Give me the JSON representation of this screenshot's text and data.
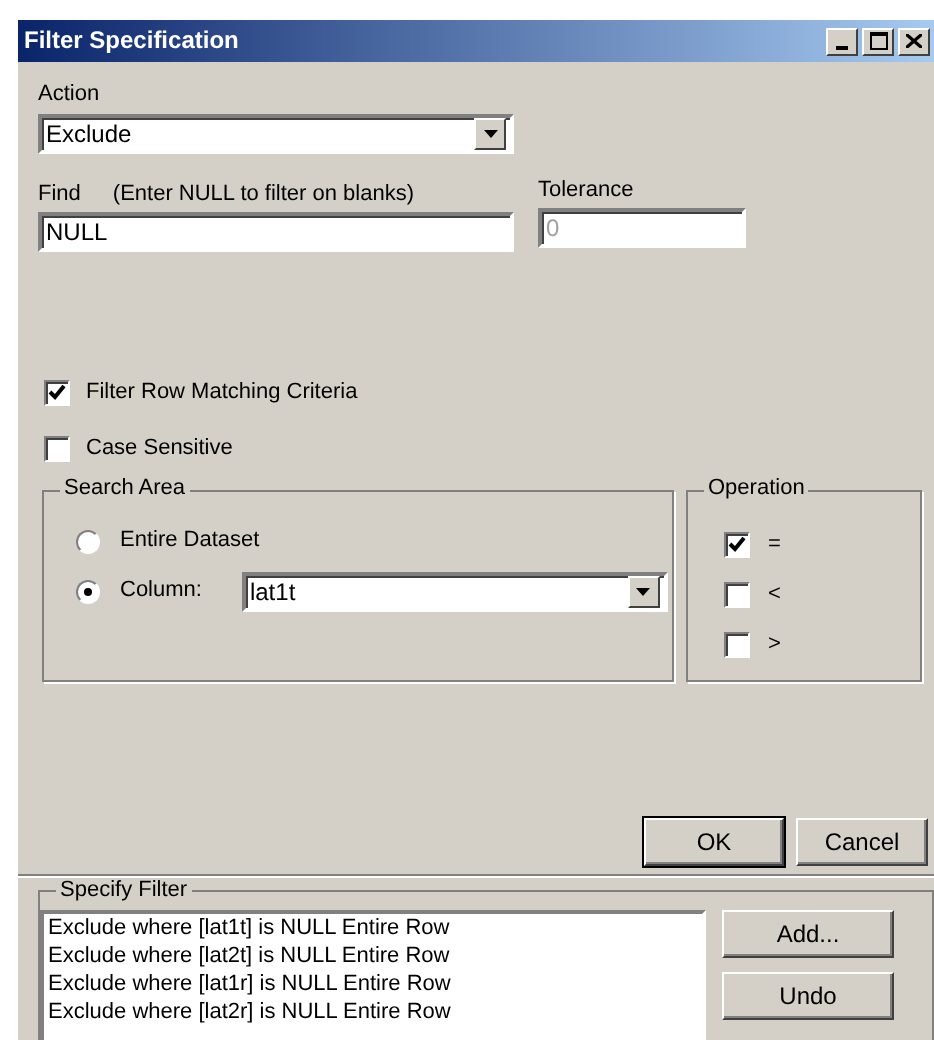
{
  "window": {
    "title": "Filter Specification"
  },
  "action": {
    "label": "Action",
    "value": "Exclude"
  },
  "find": {
    "label": "Find",
    "hint": "(Enter NULL to filter on blanks)",
    "value": "NULL"
  },
  "tolerance": {
    "label": "Tolerance",
    "value": "0",
    "disabled": true
  },
  "options": [
    {
      "label": "Filter Row Matching Criteria",
      "checked": true
    },
    {
      "label": "Case Sensitive",
      "checked": false
    }
  ],
  "search_area": {
    "title": "Search Area",
    "column_value": "lat1t",
    "options": [
      {
        "label": "Entire Dataset",
        "selected": false
      },
      {
        "label": "Column:",
        "selected": true
      }
    ]
  },
  "operation": {
    "title": "Operation",
    "items": [
      {
        "label": "=",
        "checked": true
      },
      {
        "label": "<",
        "checked": false
      },
      {
        "label": ">",
        "checked": false
      }
    ]
  },
  "buttons": [
    "OK",
    "Cancel"
  ],
  "specify_filter": {
    "title": "Specify Filter",
    "rows": [
      "Exclude where [lat1t] is NULL Entire Row",
      "Exclude where [lat2t] is NULL Entire Row",
      "Exclude where [lat1r] is NULL Entire Row",
      "Exclude where [lat2r] is NULL Entire Row"
    ],
    "buttons": [
      "Add...",
      "Undo"
    ]
  }
}
